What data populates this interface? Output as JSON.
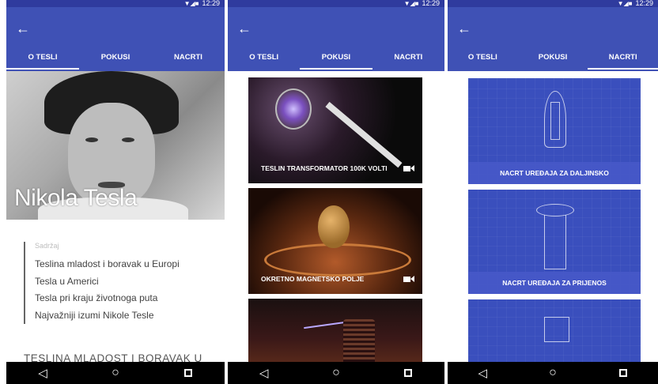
{
  "status": {
    "time": "12:29"
  },
  "tabs": [
    "O TESLI",
    "POKUSI",
    "NACRTI"
  ],
  "about": {
    "hero_title": "Nikola Tesla",
    "toc_header": "Sadržaj",
    "toc_items": [
      "Teslina mladost i boravak u Europi",
      "Tesla u Americi",
      "Tesla pri kraju životnoga puta",
      "Najvažniji izumi Nikole Tesle"
    ],
    "section_heading": "TESLINA MLADOST I BORAVAK U"
  },
  "experiments": [
    {
      "title": "TESLIN TRANSFORMATOR 100K VOLTI",
      "icon": "video-camera-icon"
    },
    {
      "title": "OKRETNO MAGNETSKO POLJE",
      "icon": "video-camera-icon"
    }
  ],
  "blueprints": [
    {
      "title": "NACRT UREĐAJA ZA DALJINSKO"
    },
    {
      "title": "NACRT UREĐAJA ZA PRIJENOS"
    }
  ],
  "colors": {
    "appbar": "#3f51b5",
    "statusbar": "#2f3b9e",
    "blueprint": "#3a4fbd"
  }
}
